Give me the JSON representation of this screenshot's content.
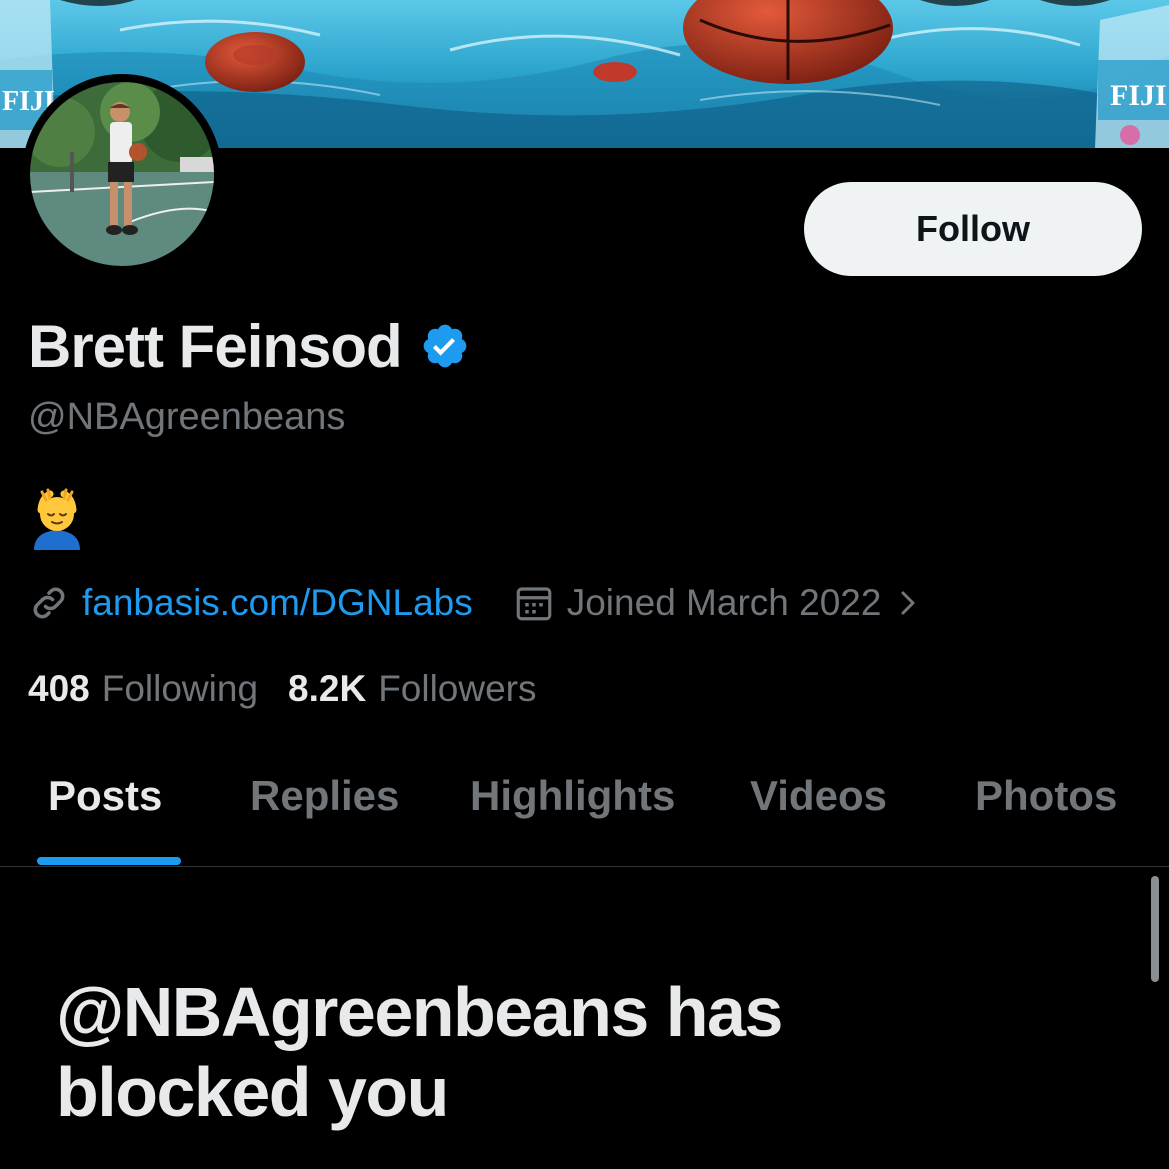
{
  "profile": {
    "display_name": "Brett Feinsod",
    "handle": "@NBAgreenbeans",
    "verified": true,
    "bio_emoji_icon": "face-massage-emoji-icon",
    "website": "fanbasis.com/DGNLabs",
    "joined": "Joined March 2022"
  },
  "banner": {
    "bottle_label_left": "FIJI",
    "bottle_label_right": "FIJI"
  },
  "actions": {
    "follow_label": "Follow"
  },
  "stats": {
    "following_count": "408",
    "following_label": "Following",
    "followers_count": "8.2K",
    "followers_label": "Followers"
  },
  "tabs": [
    {
      "label": "Posts",
      "active": true
    },
    {
      "label": "Replies",
      "active": false
    },
    {
      "label": "Highlights",
      "active": false
    },
    {
      "label": "Videos",
      "active": false
    },
    {
      "label": "Photos",
      "active": false
    }
  ],
  "blocked_message": "@NBAgreenbeans has blocked you",
  "colors": {
    "background": "#000000",
    "primary_text": "#e7e9ea",
    "secondary_text": "#71767b",
    "accent": "#1d9bf0",
    "follow_button_bg": "#eff3f4"
  }
}
